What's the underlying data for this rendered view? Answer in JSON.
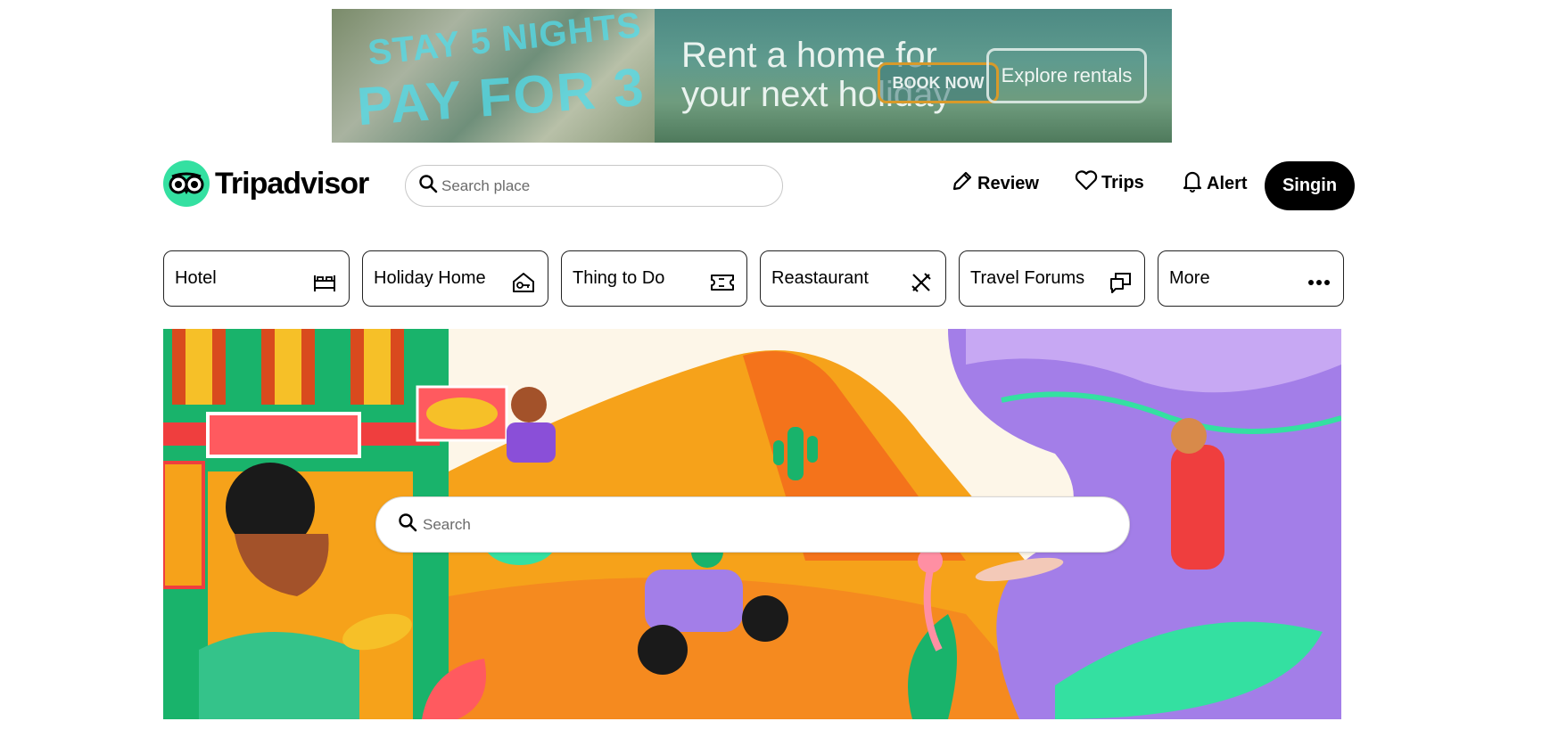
{
  "ad": {
    "left_line1": "STAY 5 NIGHTS",
    "left_line2": "PAY FOR 3",
    "right_line1": "Rent a home for",
    "right_line2": "your next holiday",
    "book_now": "BOOK NOW",
    "explore": "Explore rentals"
  },
  "header": {
    "logo_text": "Tripadvisor",
    "search_placeholder": "Search place",
    "review_label": "Review",
    "trips_label": "Trips",
    "alert_label": "Alert",
    "signin_label": "Singin"
  },
  "tabs": [
    {
      "label": "Hotel",
      "icon": "bed-icon"
    },
    {
      "label": "Holiday Home",
      "icon": "house-key-icon"
    },
    {
      "label": "Thing to Do",
      "icon": "ticket-icon"
    },
    {
      "label": "Reastaurant",
      "icon": "cutlery-icon"
    },
    {
      "label": "Travel Forums",
      "icon": "chat-bubbles-icon"
    },
    {
      "label": "More",
      "icon": "more-dots-icon"
    }
  ],
  "hero": {
    "search_placeholder": "Search"
  },
  "colors": {
    "brand_green": "#34e0a1",
    "hero_orange": "#f6a21a",
    "hero_purple": "#a37ee8",
    "hero_green": "#22b573",
    "hero_red": "#ef3e3e"
  }
}
